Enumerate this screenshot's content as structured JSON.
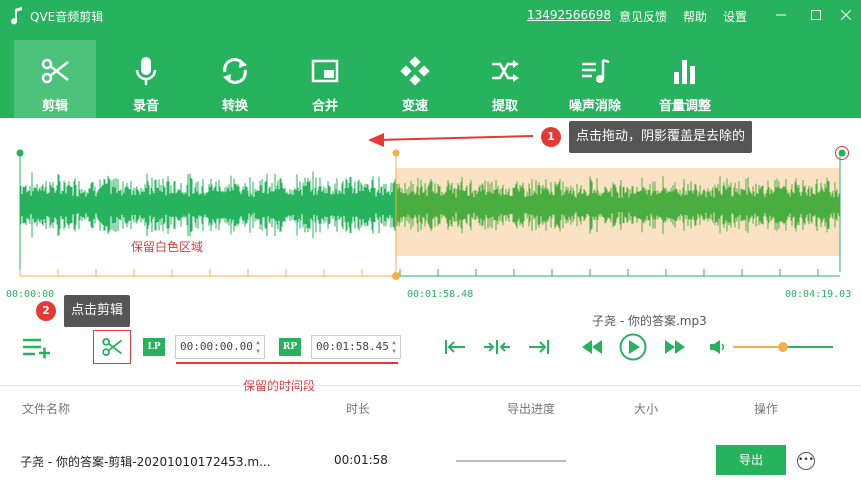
{
  "titlebar": {
    "app_title": "QVE音频剪辑",
    "phone": "13492566698",
    "feedback": "意见反馈",
    "help": "帮助",
    "settings": "设置"
  },
  "toolbar": {
    "tools": [
      {
        "label": "剪辑",
        "icon": "scissors-icon",
        "active": true
      },
      {
        "label": "录音",
        "icon": "microphone-icon"
      },
      {
        "label": "转换",
        "icon": "convert-icon"
      },
      {
        "label": "合并",
        "icon": "merge-icon"
      },
      {
        "label": "变速",
        "icon": "speed-icon"
      },
      {
        "label": "提取",
        "icon": "extract-icon"
      },
      {
        "label": "噪声消除",
        "icon": "noise-icon"
      },
      {
        "label": "音量调整",
        "icon": "volume-bars-icon"
      }
    ]
  },
  "waveform": {
    "start_time": "00:00:00",
    "marker_time": "00:01:58.48",
    "end_time": "00:04:19.03",
    "keep_label": "保留白色区域",
    "colors": {
      "wave": "#27b35d",
      "shade": "#fbe2c5",
      "marker": "#f4b04a"
    }
  },
  "callouts": {
    "drag": {
      "badge": "1",
      "text": "点击拖动，阴影覆盖是去除的"
    },
    "cut": {
      "badge": "2",
      "text": "点击剪辑"
    }
  },
  "controls": {
    "lp": "LP",
    "rp": "RP",
    "start_value": "00:00:00.00",
    "end_value": "00:01:58.45",
    "keep_range_label": "保留的时间段",
    "current_file": "子尧 - 你的答案.mp3",
    "volume_level": 0.5
  },
  "table": {
    "headers": {
      "name": "文件名称",
      "duration": "时长",
      "progress": "导出进度",
      "size": "大小",
      "action": "操作"
    },
    "rows": [
      {
        "name": "子尧 - 你的答案-剪辑-20201010172453.m...",
        "duration": "00:01:58",
        "size": "",
        "export_label": "导出"
      }
    ]
  }
}
